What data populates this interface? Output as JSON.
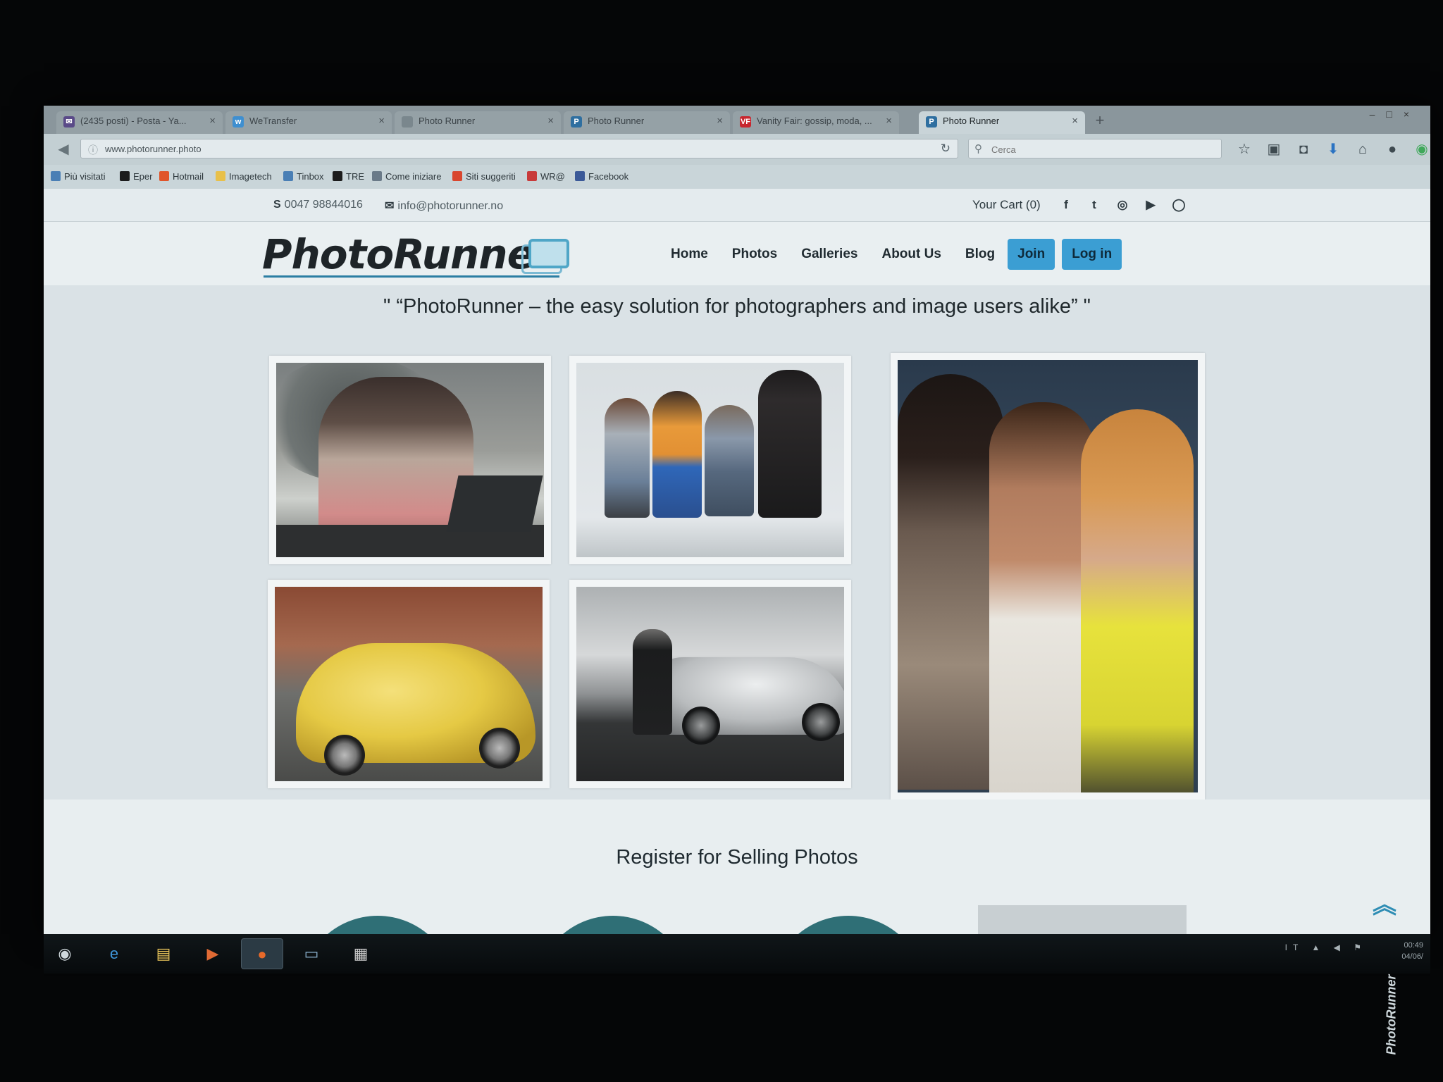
{
  "browser": {
    "tabs": [
      {
        "label": "(2435 posti) - Posta - Ya...",
        "icon": "mail-icon",
        "active": false
      },
      {
        "label": "WeTransfer",
        "icon": "wetransfer-icon",
        "active": false
      },
      {
        "label": "Photo Runner",
        "icon": "page-icon",
        "active": false
      },
      {
        "label": "Photo Runner",
        "icon": "photorunner-icon",
        "active": false
      },
      {
        "label": "Vanity Fair: gossip, moda, ...",
        "icon": "vanityfair-icon",
        "active": false
      },
      {
        "label": "Photo Runner",
        "icon": "photorunner-icon",
        "active": true
      }
    ],
    "url": "www.photorunner.photo",
    "search_placeholder": "Cerca",
    "bookmarks": [
      {
        "label": "Più visitati",
        "color": "#4a7fb5"
      },
      {
        "label": "Eper",
        "color": "#1c1c1c"
      },
      {
        "label": "Hotmail",
        "color": "#e0552a"
      },
      {
        "label": "Imagetech",
        "color": "#e8c04a"
      },
      {
        "label": "Tinbox",
        "color": "#4a7fb5"
      },
      {
        "label": "TRE",
        "color": "#1c1c1c"
      },
      {
        "label": "Come iniziare",
        "color": "#6a7a88"
      },
      {
        "label": "Siti suggeriti",
        "color": "#d9462e"
      },
      {
        "label": "WR@",
        "color": "#c83a3a"
      },
      {
        "label": "Facebook",
        "color": "#3b5998"
      }
    ]
  },
  "site": {
    "phone": "0047 98844016",
    "email": "info@photorunner.no",
    "cart": "Your Cart (0)",
    "social": [
      "facebook-icon",
      "twitter-icon",
      "instagram-icon",
      "youtube-icon",
      "whatsapp-icon"
    ],
    "logo": "PhotoRunner",
    "nav": {
      "home": "Home",
      "photos": "Photos",
      "galleries": "Galleries",
      "about": "About Us",
      "blog": "Blog",
      "join": "Join",
      "login": "Log in"
    },
    "tagline": "\" “PhotoRunner – the easy solution for photographers and image users alike” \"",
    "register_title": "Register for Selling Photos",
    "accent_color": "#3b9ed3"
  },
  "taskbar": {
    "apps": [
      "start-orb-icon",
      "internet-explorer-icon",
      "file-explorer-icon",
      "media-player-icon",
      "firefox-icon",
      "window-icon",
      "document-icon"
    ],
    "tray": "IT",
    "time": "00:49",
    "date": "04/06/"
  },
  "watermark": "PhotoRunner"
}
